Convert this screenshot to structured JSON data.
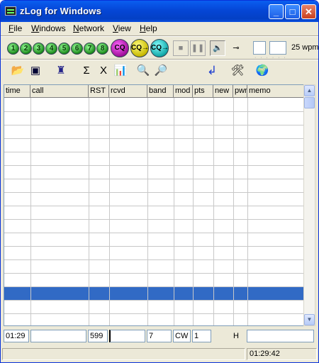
{
  "window": {
    "title": "zLog for Windows"
  },
  "menu": {
    "file": {
      "key": "F",
      "rest": "ile"
    },
    "windows": {
      "key": "W",
      "rest": "indows"
    },
    "network": {
      "key": "N",
      "rest": "etwork"
    },
    "view": {
      "key": "V",
      "rest": "iew"
    },
    "help": {
      "key": "H",
      "rest": "elp"
    }
  },
  "toolbar": {
    "numbers": [
      "1",
      "2",
      "3",
      "4",
      "5",
      "6",
      "7",
      "8"
    ],
    "cq_labels": [
      "CQ",
      "CQ→",
      "CQ→"
    ],
    "wpm": "25 wpm"
  },
  "grid": {
    "columns": [
      "time",
      "call",
      "RST",
      "rcvd",
      "band",
      "mod",
      "pts",
      "new",
      "pwr",
      "memo"
    ],
    "selected_row": 14
  },
  "entry": {
    "time": "01:29",
    "call": "",
    "rst": "599",
    "rcvd": "",
    "band": "7",
    "mode": "CW",
    "points": "1",
    "power": "H",
    "memo": ""
  },
  "status": {
    "clock": "01:29:42"
  },
  "colors": {
    "selection": "#316ac5",
    "titlebar": "#0546d6"
  }
}
